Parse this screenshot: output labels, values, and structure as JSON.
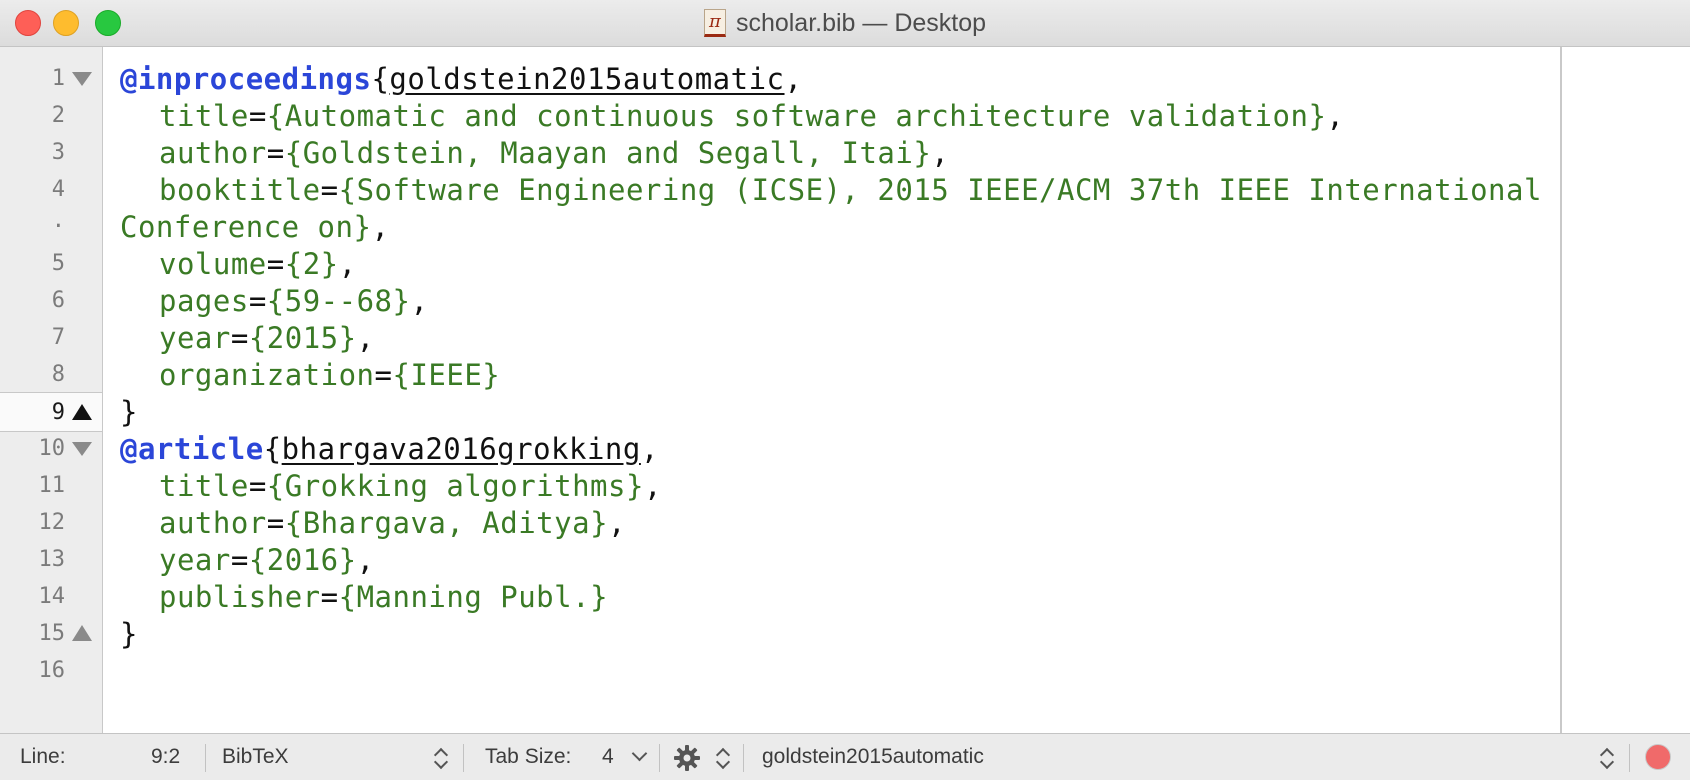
{
  "window": {
    "title": "scholar.bib — Desktop",
    "doc_icon_glyph": "π"
  },
  "gutter": {
    "rows": [
      {
        "label": "1",
        "fold": "down"
      },
      {
        "label": "2",
        "fold": ""
      },
      {
        "label": "3",
        "fold": ""
      },
      {
        "label": "4",
        "fold": ""
      },
      {
        "label": "·",
        "fold": ""
      },
      {
        "label": "5",
        "fold": ""
      },
      {
        "label": "6",
        "fold": ""
      },
      {
        "label": "7",
        "fold": ""
      },
      {
        "label": "8",
        "fold": ""
      },
      {
        "label": "9",
        "fold": "up",
        "current": true
      },
      {
        "label": "10",
        "fold": "down"
      },
      {
        "label": "11",
        "fold": ""
      },
      {
        "label": "12",
        "fold": ""
      },
      {
        "label": "13",
        "fold": ""
      },
      {
        "label": "14",
        "fold": ""
      },
      {
        "label": "15",
        "fold": "up"
      },
      {
        "label": "16",
        "fold": ""
      }
    ]
  },
  "editor": {
    "entry1": {
      "type": "@inproceedings",
      "key": "goldstein2015automatic",
      "fields": [
        {
          "name": "title",
          "value": "Automatic and continuous software architecture validation",
          "tail": "},"
        },
        {
          "name": "author",
          "value": "Goldstein, Maayan and Segall, Itai",
          "tail": "},"
        },
        {
          "name": "booktitle",
          "value": "Software Engineering (ICSE), 2015 IEEE/ACM 37th IEEE International",
          "tail": ""
        },
        {
          "name": "volume",
          "value": "2",
          "tail": "},"
        },
        {
          "name": "pages",
          "value": "59--68",
          "tail": "},"
        },
        {
          "name": "year",
          "value": "2015",
          "tail": "},"
        },
        {
          "name": "organization",
          "value": "IEEE",
          "tail": "}"
        }
      ],
      "wrap": "Conference on",
      "close": "}"
    },
    "entry2": {
      "type": "@article",
      "key": "bhargava2016grokking",
      "fields": [
        {
          "name": "title",
          "value": "Grokking algorithms",
          "tail": "},"
        },
        {
          "name": "author",
          "value": "Bhargava, Aditya",
          "tail": "},"
        },
        {
          "name": "year",
          "value": "2016",
          "tail": "},"
        },
        {
          "name": "publisher",
          "value": "Manning Publ.",
          "tail": "}"
        }
      ],
      "close": "}"
    }
  },
  "statusbar": {
    "line_label": "Line:",
    "line_value": "9:2",
    "syntax": "BibTeX",
    "tab_size_label": "Tab Size:",
    "tab_size_value": "4",
    "symbol": "goldstein2015automatic"
  },
  "colors": {
    "keyword": "#2b46d8",
    "field": "#3a7a25"
  }
}
